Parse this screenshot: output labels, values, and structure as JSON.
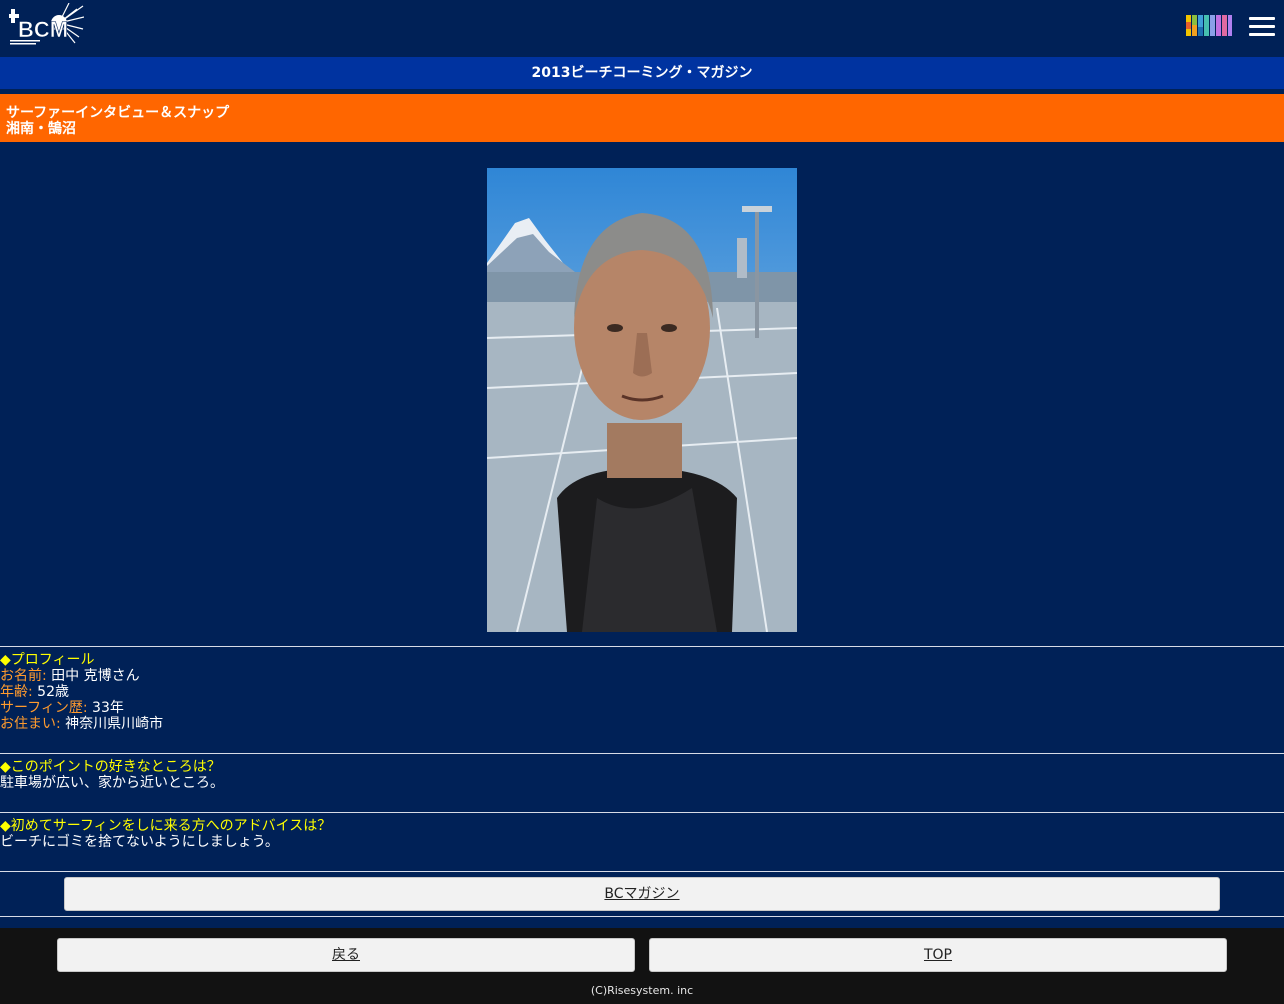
{
  "header": {
    "logo_icon": "bcm-logo",
    "logo_text": "BCM",
    "menu_icon": "hamburger-menu-icon",
    "color_icon": "color-swatches-icon"
  },
  "title_bar": {
    "text": "2013ビーチコーミング・マガジン"
  },
  "section_header": {
    "line1": "サーファーインタビュー＆スナップ",
    "line2": "湘南・鵠沼"
  },
  "profile": {
    "heading": "◆プロフィール",
    "fields": [
      {
        "label": "お名前:",
        "value": " 田中 克博さん"
      },
      {
        "label": "年齢:",
        "value": " 52歳"
      },
      {
        "label": "サーフィン歴:",
        "value": " 33年"
      },
      {
        "label": "お住まい:",
        "value": " 神奈川県川崎市"
      }
    ]
  },
  "qa": [
    {
      "question": "◆このポイントの好きなところは？",
      "answer": "駐車場が広い、家から近いところ。"
    },
    {
      "question": "◆初めてサーフィンをしに来る方へのアドバイスは？",
      "answer": "ビーチにゴミを捨てないようにしましょう。"
    }
  ],
  "buttons": {
    "bc_magazine": "BCマガジン",
    "back": "戻る",
    "top": "TOP"
  },
  "footer": {
    "copyright": "(C)Risesystem. inc"
  },
  "colors": {
    "background": "#002157",
    "title_bar": "#0033a0",
    "orange": "#ff6600",
    "label": "#ff9b2e",
    "heading": "#ffff00"
  }
}
